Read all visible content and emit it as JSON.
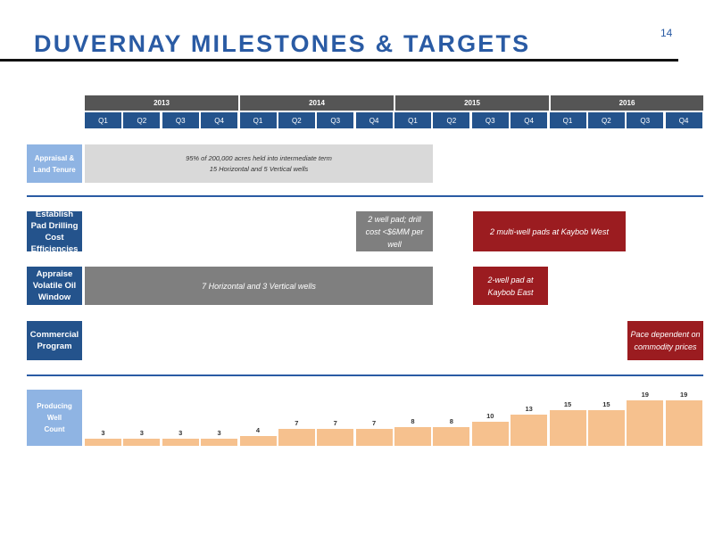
{
  "header": {
    "title": "DUVERNAY MILESTONES & TARGETS",
    "page_number": "14"
  },
  "timeline": {
    "years": [
      "2013",
      "2014",
      "2015",
      "2016"
    ],
    "quarters": [
      "Q1",
      "Q2",
      "Q3",
      "Q4",
      "Q1",
      "Q2",
      "Q3",
      "Q4",
      "Q1",
      "Q2",
      "Q3",
      "Q4",
      "Q1",
      "Q2",
      "Q3",
      "Q4"
    ]
  },
  "rows": {
    "appraisal": {
      "label": "Appraisal & Land Tenure",
      "bar_line1": "95% of 200,000 acres held into intermediate term",
      "bar_line2": "15 Horizontal and 5 Vertical wells"
    },
    "establish_pad": {
      "label": "Establish Pad Drilling Cost Efficiencies",
      "bar1": "2 well pad; drill cost <$6MM per well",
      "bar2": "2 multi-well pads at Kaybob West"
    },
    "appraise_oil": {
      "label": "Appraise Volatile Oil Window",
      "bar1": "7 Horizontal and 3 Vertical wells",
      "bar2": "2-well pad at Kaybob East"
    },
    "commercial": {
      "label": "Commercial Program",
      "bar1": "Pace dependent on commodity prices"
    },
    "producing": {
      "label": "Producing Well Count"
    }
  },
  "colors": {
    "accent": "#2a5ba4",
    "header_dark": "#555555",
    "quarter_blue": "#24538c",
    "light_blue": "#8fb4e3",
    "bar_gray": "#7f7f7f",
    "bar_light": "#d9d9d9",
    "bar_red": "#9b1c20",
    "well_orange": "#f6c18e"
  },
  "chart_data": {
    "type": "bar",
    "title": "",
    "categories": [
      "Q1 2013",
      "Q2 2013",
      "Q3 2013",
      "Q4 2013",
      "Q1 2014",
      "Q2 2014",
      "Q3 2014",
      "Q4 2014",
      "Q1 2015",
      "Q2 2015",
      "Q3 2015",
      "Q4 2015",
      "Q1 2016",
      "Q2 2016",
      "Q3 2016",
      "Q4 2016"
    ],
    "values": [
      3,
      3,
      3,
      3,
      4,
      7,
      7,
      7,
      8,
      8,
      10,
      13,
      15,
      15,
      19,
      19
    ],
    "ylim": [
      0,
      19
    ],
    "grid": false,
    "data_labels": true
  }
}
